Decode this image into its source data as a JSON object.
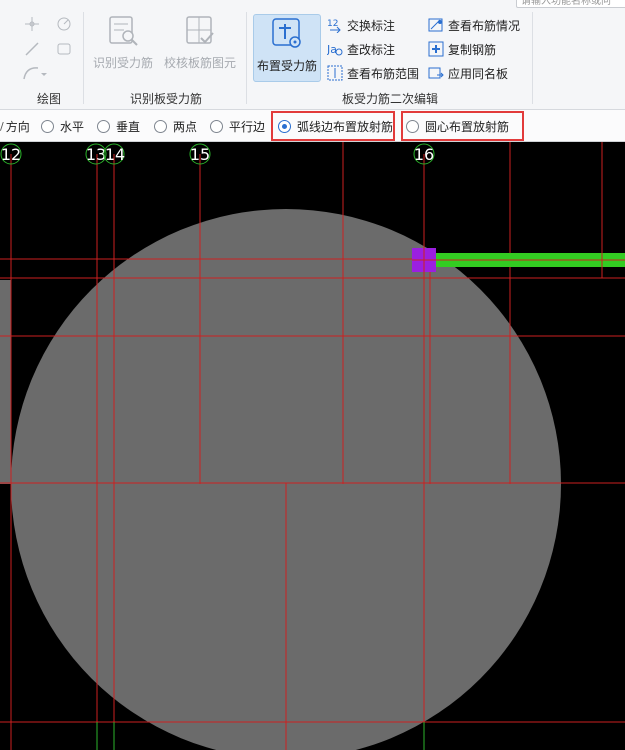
{
  "ribbon": {
    "search_placeholder": "请输入功能名称或问",
    "groups": {
      "draw": "绘图",
      "identify": "识别板受力筋",
      "edit": "板受力筋二次编辑"
    },
    "buttons": {
      "identify_rebar": "识别受力筋",
      "check_diagram": "校核板筋图元",
      "place_rebar": "布置受力筋",
      "swap_label": "交换标注",
      "modify_label": "查改标注",
      "view_range": "查看布筋范围",
      "view_status": "查看布筋情况",
      "copy_rebar": "复制钢筋",
      "apply_same": "应用同名板"
    }
  },
  "options": {
    "direction_partial": "方向",
    "horizontal": "水平",
    "vertical": "垂直",
    "two_points": "两点",
    "parallel_edge": "平行边",
    "arc_radial": "弧线边布置放射筋",
    "center_radial": "圆心布置放射筋",
    "selected": "arc_radial"
  },
  "axes": {
    "labels": [
      "12",
      "13",
      "14",
      "15",
      "16"
    ]
  },
  "colors": {
    "canvas_bg": "#000000",
    "slab_fill": "#6b6b6b",
    "grid_line": "#cc2020",
    "axis_circle": "#2bb32b",
    "rebar": "#33cc22",
    "rebar_node": "#9b1fe0",
    "highlight": "#e23b3b",
    "accent": "#2a6fd0"
  }
}
